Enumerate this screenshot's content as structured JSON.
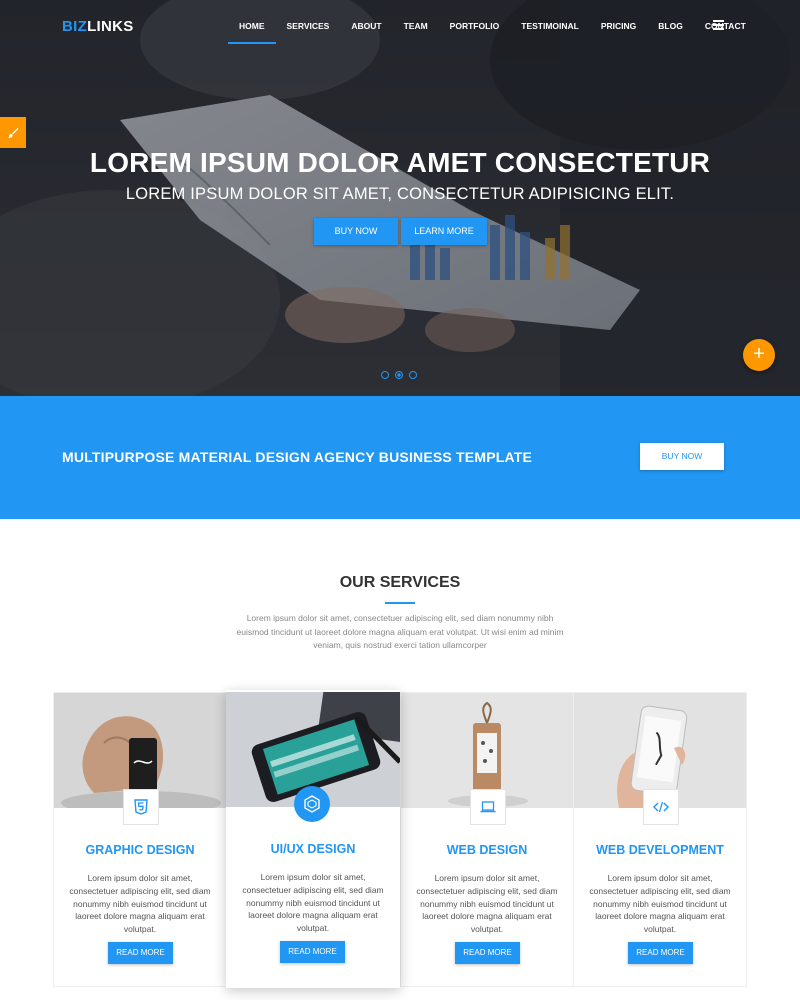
{
  "brand": {
    "part1": "BIZ",
    "part2": "LINKS"
  },
  "nav": {
    "items": [
      "HOME",
      "SERVICES",
      "ABOUT",
      "TEAM",
      "PORTFOLIO",
      "TESTIMOINAL",
      "PRICING",
      "BLOG",
      "CONTACT"
    ],
    "active": "HOME",
    "menu_icon": "hamburger-icon"
  },
  "hero": {
    "title": "LOREM IPSUM DOLOR AMET CONSECTETUR",
    "subtitle": "LOREM IPSUM DOLOR SIT AMET, CONSECTETUR ADIPISICING ELIT.",
    "buy_label": "BUY NOW",
    "learn_label": "LEARN MORE",
    "slide_count": 3,
    "active_slide": 2
  },
  "cta": {
    "text": "MULTIPURPOSE MATERIAL DESIGN AGENCY BUSINESS TEMPLATE",
    "button": "BUY NOW"
  },
  "services": {
    "title": "OUR SERVICES",
    "description": "Lorem ipsum dolor sit amet, consectetuer adipiscing elit, sed diam nonummy nibh euismod tincidunt ut laoreet dolore magna aliquam erat volutpat. Ut wisi enim ad minim veniam, quis nostrud exerci tation ullamcorper",
    "cards": [
      {
        "title": "GRAPHIC DESIGN",
        "text": "Lorem ipsum dolor sit amet, consectetuer adipiscing elit, sed diam nonummy nibh euismod tincidunt ut laoreet dolore magna aliquam erat volutpat.",
        "button": "READ MORE",
        "icon": "html5-icon"
      },
      {
        "title": "UI/UX DESIGN",
        "text": "Lorem ipsum dolor sit amet, consectetuer adipiscing elit, sed diam nonummy nibh euismod tincidunt ut laoreet dolore magna aliquam erat volutpat.",
        "button": "READ MORE",
        "icon": "hexagon-icon"
      },
      {
        "title": "WEB DESIGN",
        "text": "Lorem ipsum dolor sit amet, consectetuer adipiscing elit, sed diam nonummy nibh euismod tincidunt ut laoreet dolore magna aliquam erat volutpat.",
        "button": "READ MORE",
        "icon": "laptop-icon"
      },
      {
        "title": "WEB DEVELOPMENT",
        "text": "Lorem ipsum dolor sit amet, consectetuer adipiscing elit, sed diam nonummy nibh euismod tincidunt ut laoreet dolore magna aliquam erat volutpat.",
        "button": "READ MORE",
        "icon": "code-icon"
      }
    ]
  },
  "colors": {
    "primary": "#2196f3",
    "accent": "#ff9800",
    "hero_dark": "#2c2f36"
  },
  "widgets": {
    "style_switcher_icon": "brush-icon",
    "fab_icon": "plus-icon"
  }
}
